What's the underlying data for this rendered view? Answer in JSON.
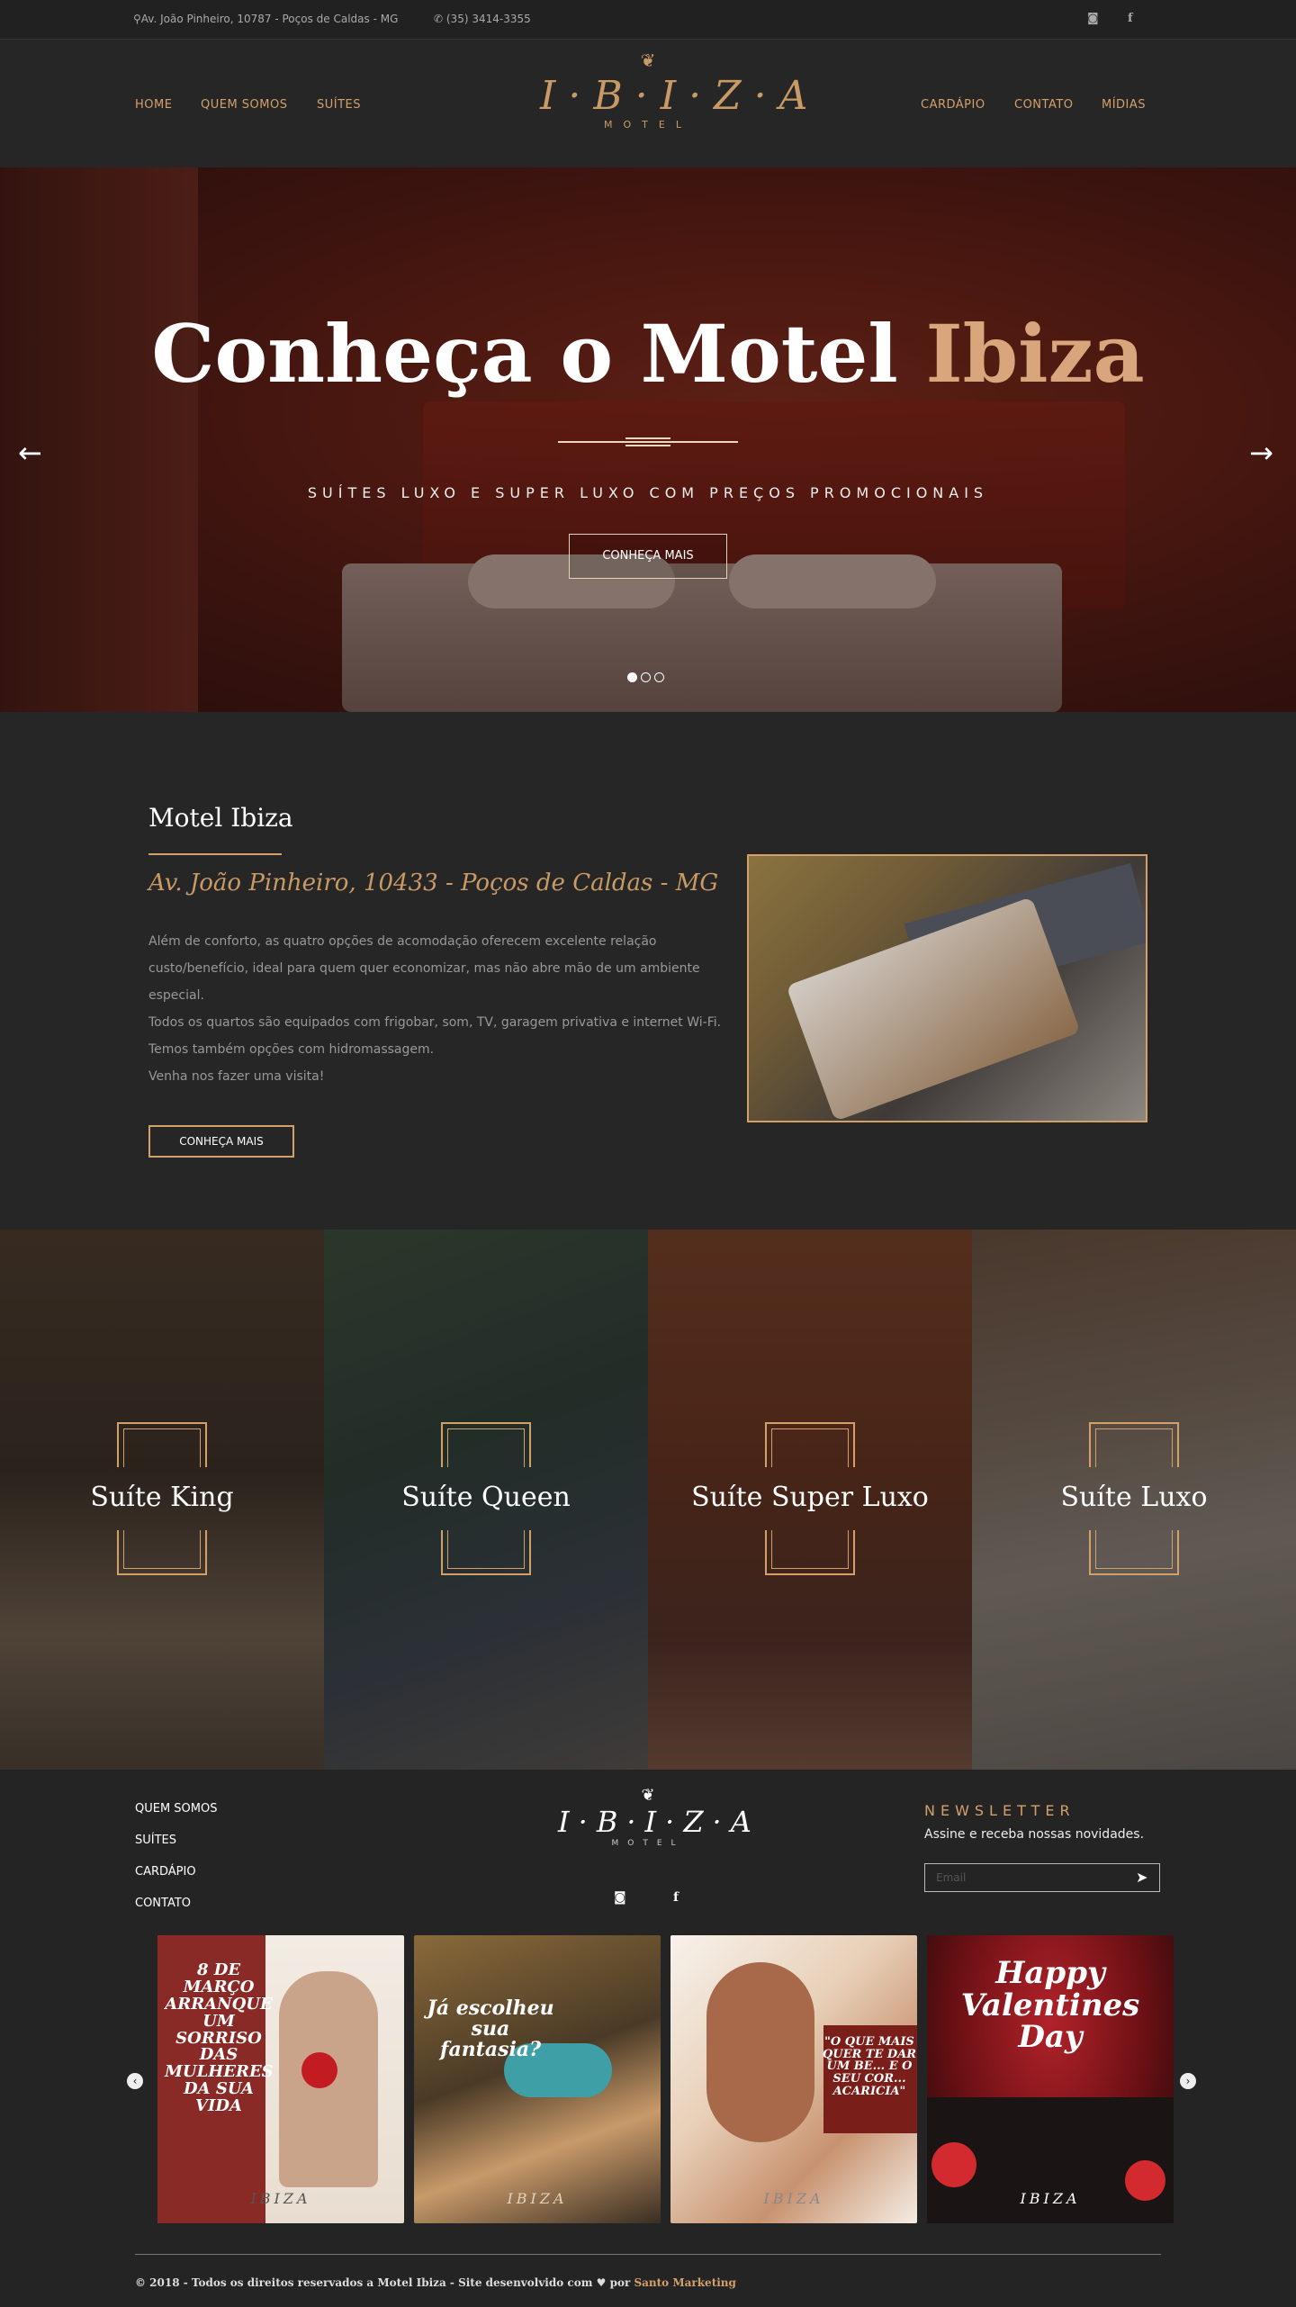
{
  "topbar": {
    "address": "Av. João Pinheiro, 10787 - Poços de Caldas - MG",
    "phone": "(35) 3414-3355",
    "address_icon": "map-pin-icon",
    "phone_icon": "phone-icon",
    "social": [
      "instagram-icon",
      "facebook-icon"
    ]
  },
  "nav": {
    "left": [
      "HOME",
      "QUEM SOMOS",
      "SUÍTES"
    ],
    "right": [
      "CARDÁPIO",
      "CONTATO",
      "MÍDIAS"
    ]
  },
  "logo": {
    "word": "I·B·I·Z·A",
    "sub": "MOTEL"
  },
  "hero": {
    "title_main": "Conheça o Motel ",
    "title_accent": "Ibiza",
    "subtitle": "SUÍTES LUXO E SUPER LUXO COM PREÇOS PROMOCIONAIS",
    "cta": "CONHEÇA MAIS",
    "slides_total": 3,
    "active_slide": 1
  },
  "about": {
    "title": "Motel Ibiza",
    "address": "Av. João Pinheiro, 10433 - Poços de Caldas - MG",
    "paragraphs": [
      "Além de conforto, as quatro opções de acomodação oferecem excelente relação custo/benefício, ideal para quem quer economizar, mas não abre mão de um ambiente especial.",
      "Todos os quartos são equipados com frigobar, som, TV, garagem privativa e internet Wi-Fi.",
      "Temos também opções com hidromassagem.",
      "Venha nos fazer uma visita!"
    ],
    "button": "CONHEÇA MAIS"
  },
  "suites": [
    {
      "name": "Suíte King"
    },
    {
      "name": "Suíte Queen"
    },
    {
      "name": "Suíte Super Luxo"
    },
    {
      "name": "Suíte Luxo"
    }
  ],
  "footer": {
    "links": [
      "QUEM SOMOS",
      "SUÍTES",
      "CARDÁPIO",
      "CONTATO"
    ],
    "logo_word": "I·B·I·Z·A",
    "logo_sub": "MOTEL",
    "newsletter_title": "NEWSLETTER",
    "newsletter_sub": "Assine e receba nossas novidades.",
    "email_placeholder": "Email",
    "gallery": [
      {
        "caption": "8 DE MARÇO ARRANQUE UM SORRISO DAS MULHERES DA SUA VIDA"
      },
      {
        "caption": "Já escolheu sua fantasia?"
      },
      {
        "caption": "\"O QUE MAIS QUER TE DAR UM BE... E O SEU COR... ACARICIA\""
      },
      {
        "caption": "Happy Valentines Day"
      }
    ],
    "gallery_logo": "IBIZA",
    "copyright": "© 2018 - Todos os direitos reservados a Motel Ibiza - Site desenvolvido com ",
    "heart": "♥",
    "by": " por ",
    "developer": "Santo Marketing"
  },
  "colors": {
    "accent": "#d4a06a",
    "background": "#262626",
    "topbar": "#212121"
  }
}
